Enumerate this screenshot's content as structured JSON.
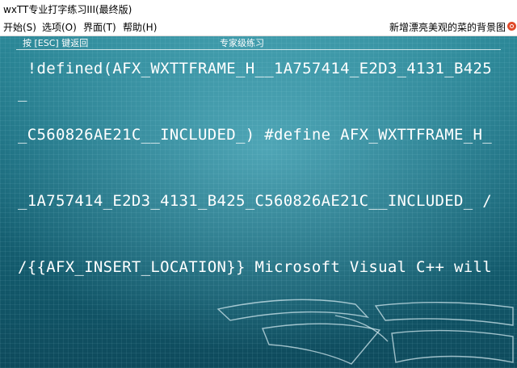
{
  "window": {
    "title": "wxTT专业打字练习III(最终版)"
  },
  "menu": {
    "items": [
      {
        "label": "开始(S)",
        "shortcut": "S"
      },
      {
        "label": "选项(O)",
        "shortcut": "O"
      },
      {
        "label": "界面(T)",
        "shortcut": "T"
      },
      {
        "label": "帮助(H)",
        "shortcut": "H"
      }
    ],
    "right_text": "新增漂亮美观的菜的背景图"
  },
  "status": {
    "hint": "按 [ESC] 键返回",
    "level": "专家级练习"
  },
  "practice": {
    "lines": [
      " !defined(AFX_WXTTFRAME_H__1A757414_E2D3_4131_B425",
      "_",
      "_C560826AE21C__INCLUDED_) #define AFX_WXTTFRAME_H_",
      "_1A757414_E2D3_4131_B425_C560826AE21C__INCLUDED_ /",
      "/{{AFX_INSERT_LOCATION}} Microsoft Visual C++ will"
    ]
  },
  "colors": {
    "background_top": "#2c8898",
    "background_bottom": "#0e4a5c",
    "text": "#ffffff",
    "close_icon": "#e04a2a"
  }
}
